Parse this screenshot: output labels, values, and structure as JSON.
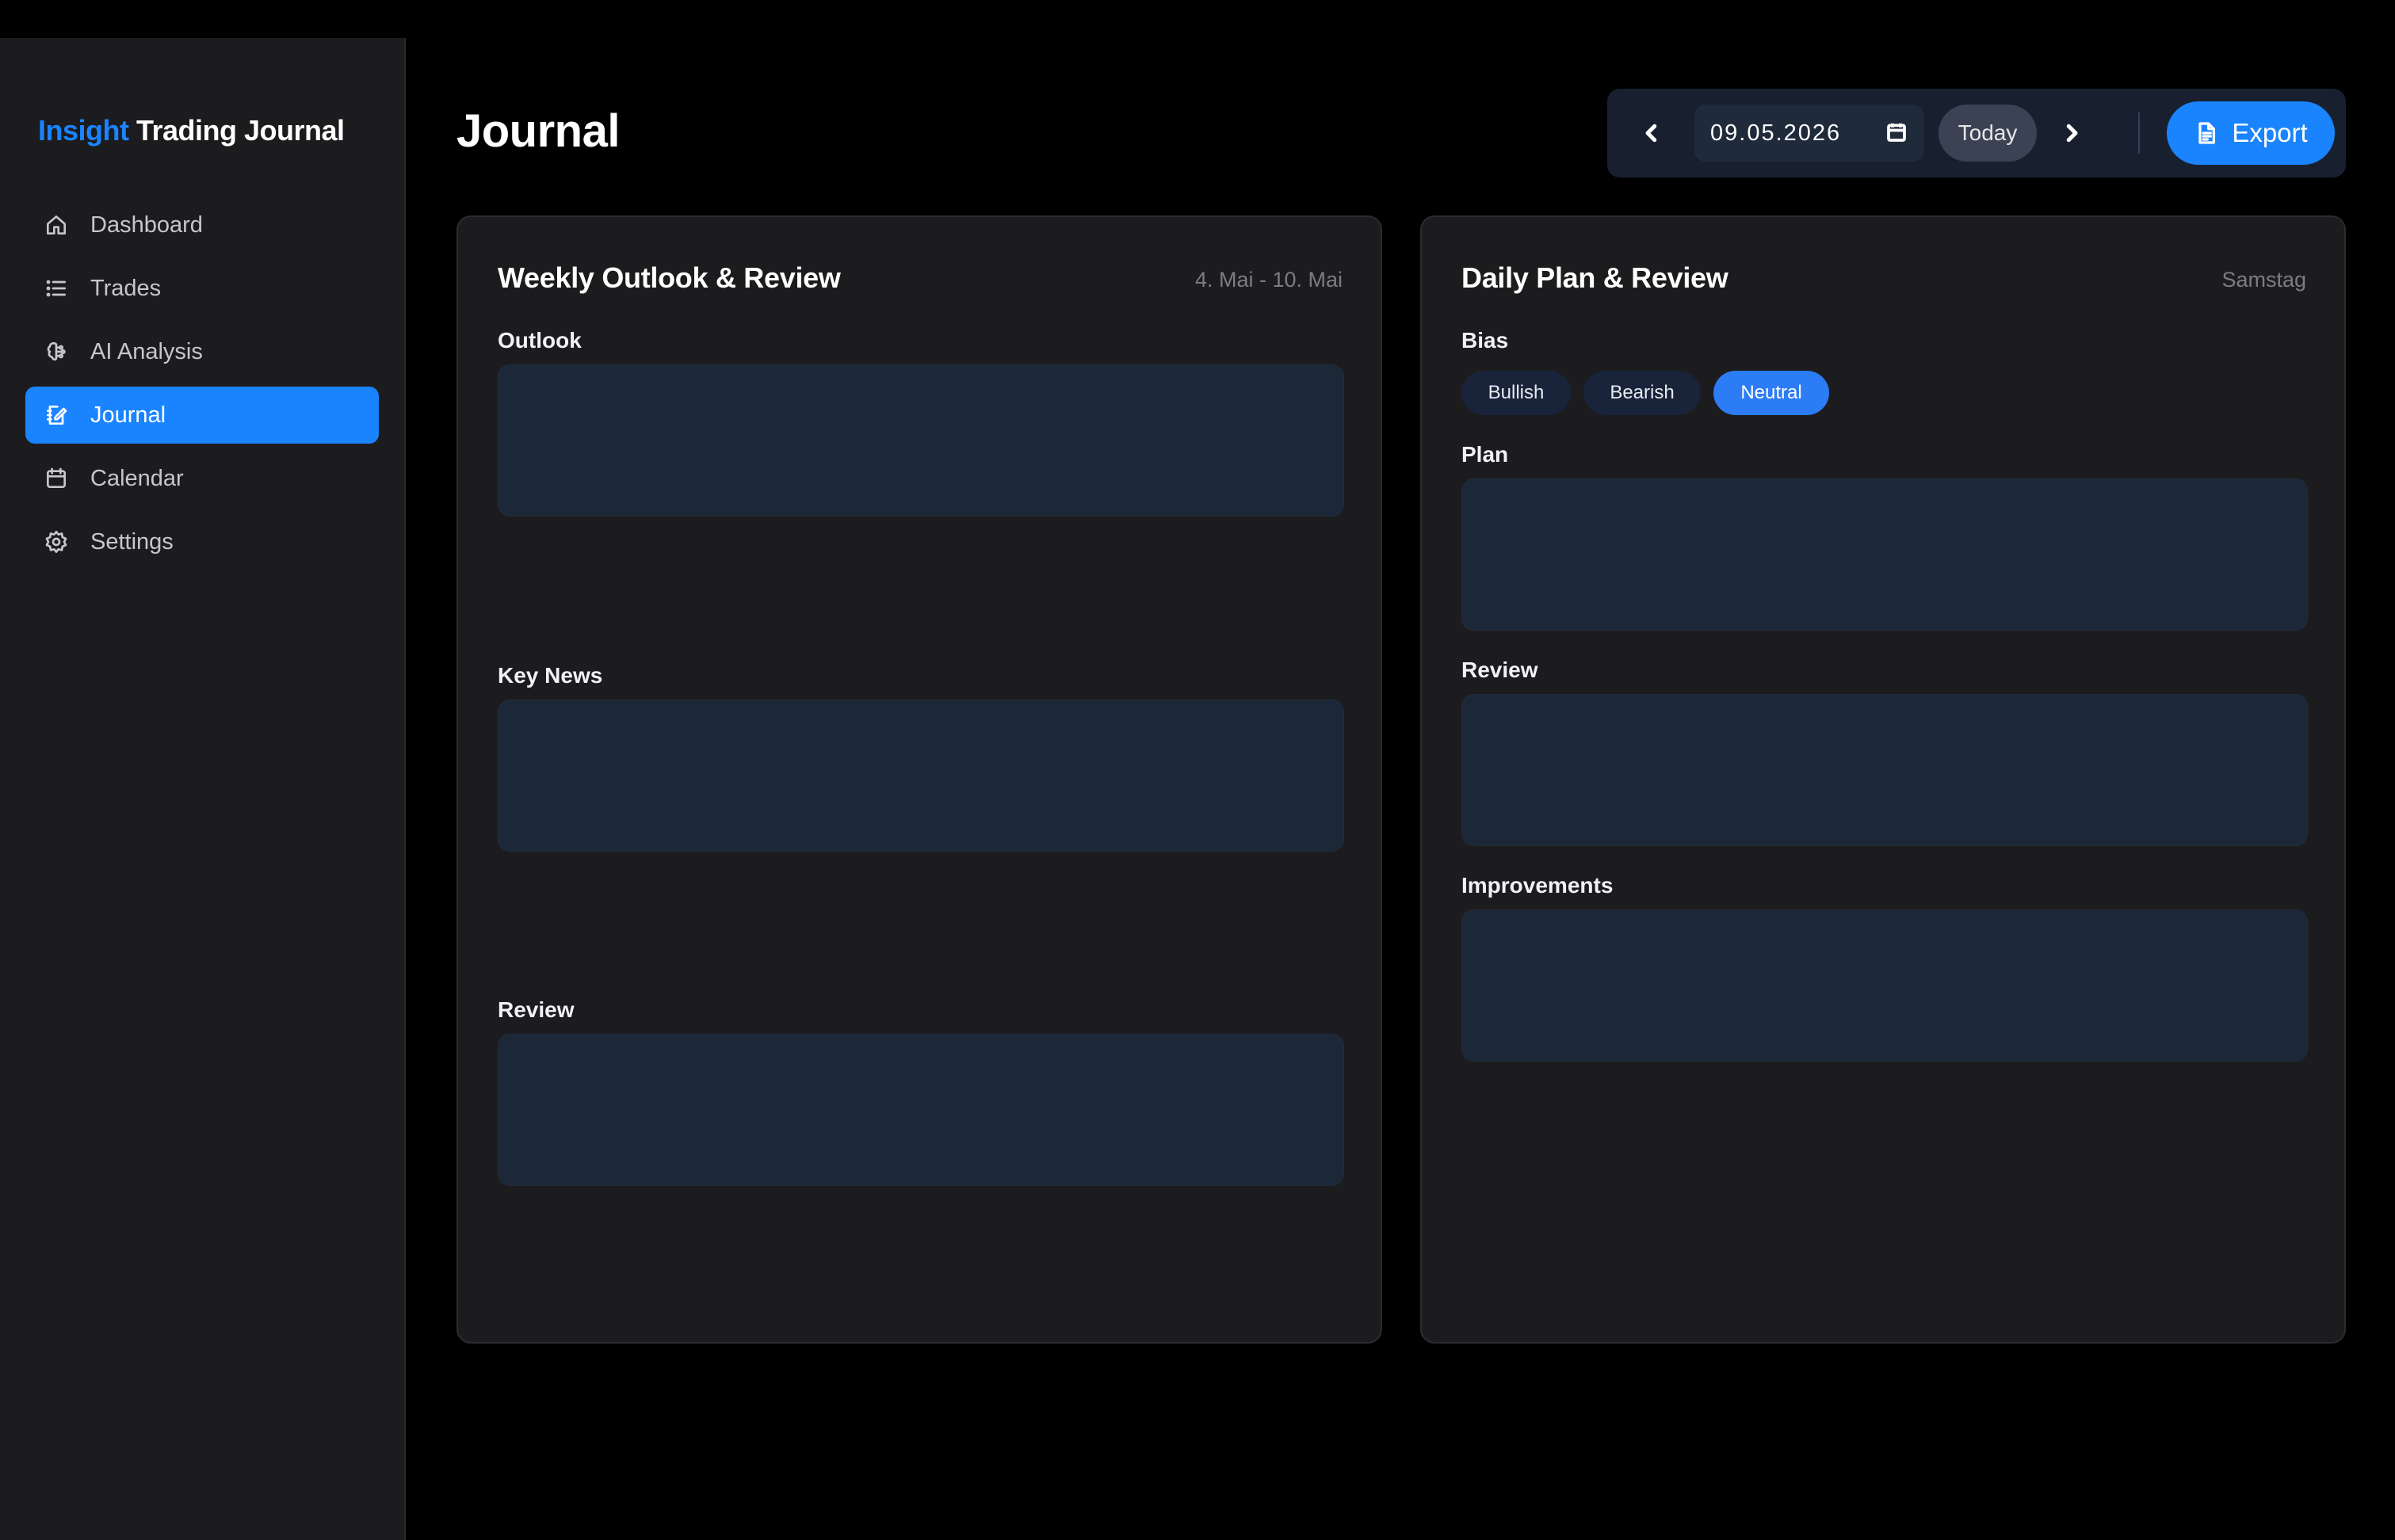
{
  "brand": {
    "part1": "Insight",
    "part2": "Trading Journal",
    "accent_color": "#1a84ff"
  },
  "sidebar": {
    "items": [
      {
        "label": "Dashboard",
        "icon": "home-icon",
        "active": false
      },
      {
        "label": "Trades",
        "icon": "list-icon",
        "active": false
      },
      {
        "label": "AI Analysis",
        "icon": "brain-icon",
        "active": false
      },
      {
        "label": "Journal",
        "icon": "journal-icon",
        "active": true
      },
      {
        "label": "Calendar",
        "icon": "calendar-icon",
        "active": false
      },
      {
        "label": "Settings",
        "icon": "gear-icon",
        "active": false
      }
    ]
  },
  "header": {
    "title": "Journal"
  },
  "toolbar": {
    "prev_icon": "chevron-left-icon",
    "date_value": "09.05.2026",
    "date_icon": "calendar-icon",
    "today_label": "Today",
    "next_icon": "chevron-right-icon",
    "export_label": "Export",
    "export_icon": "document-icon"
  },
  "weekly": {
    "title": "Weekly Outlook & Review",
    "range": "4. Mai - 10. Mai",
    "outlook_label": "Outlook",
    "outlook_value": "",
    "news_label": "Key News",
    "news_value": "",
    "review_label": "Review",
    "review_value": ""
  },
  "daily": {
    "title": "Daily Plan & Review",
    "day": "Samstag",
    "bias_label": "Bias",
    "bias_options": [
      "Bullish",
      "Bearish",
      "Neutral"
    ],
    "bias_selected": "Neutral",
    "plan_label": "Plan",
    "plan_value": "",
    "review_label": "Review",
    "review_value": "",
    "improvements_label": "Improvements",
    "improvements_value": ""
  },
  "colors": {
    "background": "#000000",
    "panel": "#1c1c1e",
    "input": "#1c2737",
    "accent": "#1a84ff"
  }
}
